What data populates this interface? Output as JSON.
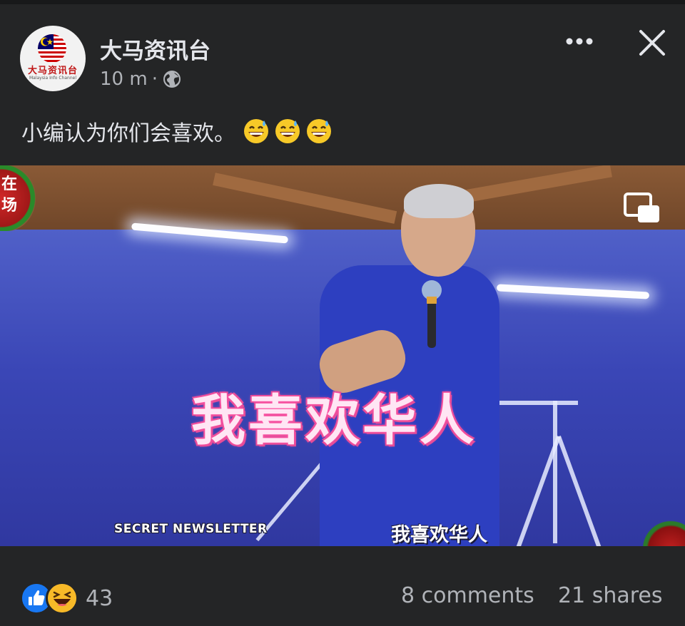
{
  "post": {
    "page_name": "大马资讯台",
    "time": "10 m",
    "separator": "·",
    "privacy_icon": "globe-icon",
    "caption": "小编认为你们会喜欢。",
    "caption_emojis": [
      "grinning-sweat-emoji",
      "grinning-sweat-emoji",
      "grinning-sweat-emoji"
    ],
    "avatar": {
      "logo_text": "大马资讯台",
      "logo_subtext": "Malaysia Info Channel"
    }
  },
  "video": {
    "big_subtitle": "我喜欢华人",
    "small_subtitle": "我喜欢华人",
    "watermark": "SECRET NEWSLETTER",
    "live_badge_text": [
      "在",
      "场"
    ],
    "pip_icon": "picture-in-picture-icon"
  },
  "footer": {
    "reactions": [
      "like-icon",
      "haha-icon"
    ],
    "reaction_count": "43",
    "comments": "8 comments",
    "shares": "21 shares"
  },
  "colors": {
    "background": "#242526",
    "text_primary": "#e4e6eb",
    "text_secondary": "#b0b3b8",
    "like_blue": "#1877f2",
    "haha_yellow": "#f7b928",
    "subtitle_pink": "#e24b96"
  }
}
